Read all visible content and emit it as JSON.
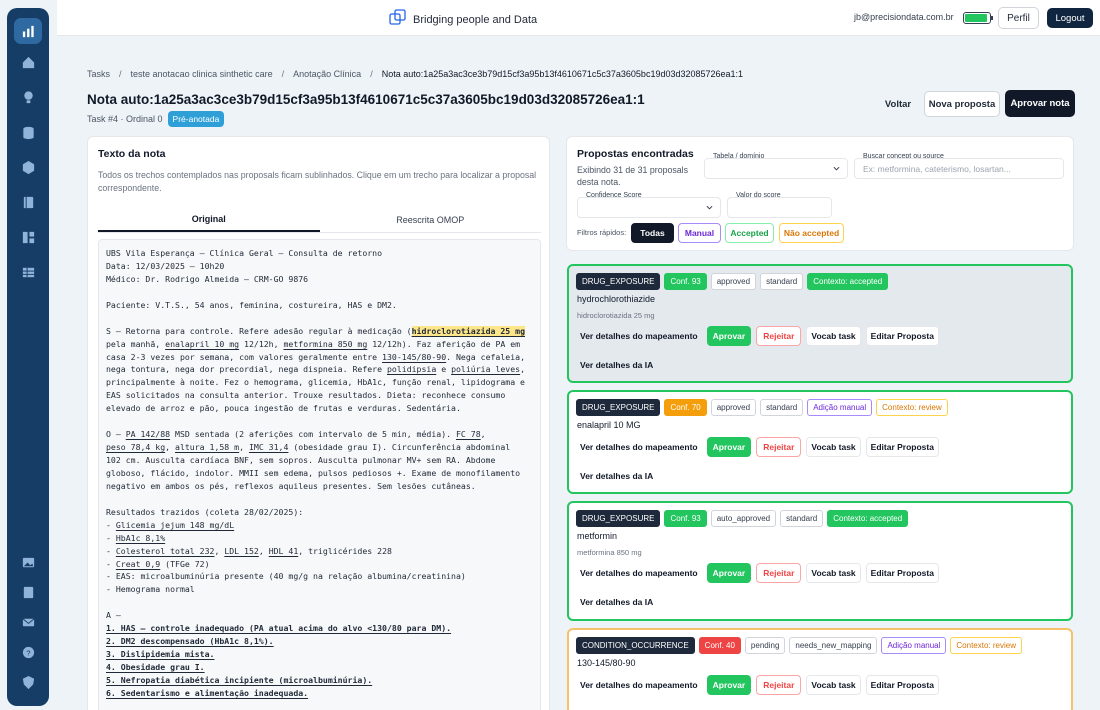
{
  "topbar": {
    "brand": "Bridging people and Data",
    "user_email": "jb@precisiondata.com.br",
    "battery_level": 0.9,
    "perfil_label": "Perfil",
    "logout_label": "Logout"
  },
  "breadcrumb": [
    "Tasks",
    "teste anotacao clinica sinthetic care",
    "Anotação Clínica",
    "Nota auto:1a25a3ac3ce3b79d15cf3a95b13f4610671c5c37a3605bc19d03d32085726ea1:1"
  ],
  "page": {
    "title": "Nota auto:1a25a3ac3ce3b79d15cf3a95b13f4610671c5c37a3605bc19d03d32085726ea1:1",
    "task_meta": "Task #4 · Ordinal 0",
    "status_badge": "Pré-anotada",
    "voltar_label": "Voltar",
    "nova_label": "Nova proposta",
    "aprovar_label": "Aprovar nota"
  },
  "note_panel": {
    "title": "Texto da nota",
    "description": "Todos os trechos contemplados nas proposals ficam sublinhados. Clique em um trecho para localizar a proposal correspondente.",
    "tabs": [
      "Original",
      "Reescrita OMOP"
    ],
    "lines": [
      [
        {
          "t": "UBS Vila Esperança — Clínica Geral — Consulta de retorno"
        }
      ],
      [
        {
          "t": "Data: 12/03/2025 — 10h20"
        }
      ],
      [
        {
          "t": "Médico: Dr. Rodrigo Almeida — CRM-GO 9876"
        }
      ],
      [
        {
          "t": ""
        }
      ],
      [
        {
          "t": "Paciente: V.T.S., 54 anos, feminina, costureira, HAS e DM2."
        }
      ],
      [
        {
          "t": ""
        }
      ],
      [
        {
          "t": "S — Retorna para controle. Refere adesão regular à medicação ("
        },
        {
          "t": "hidroclorotiazida 25 mg",
          "s": "strong"
        }
      ],
      [
        {
          "t": "pela manhã, "
        },
        {
          "t": "enalapril 10 mg",
          "s": "u"
        },
        {
          "t": " 12/12h, "
        },
        {
          "t": "metformina 850 mg",
          "s": "u"
        },
        {
          "t": " 12/12h). Faz aferição de PA em"
        }
      ],
      [
        {
          "t": "casa 2-3 vezes por semana, com valores geralmente entre "
        },
        {
          "t": "130-145/80-90",
          "s": "u"
        },
        {
          "t": ". Nega cefaleia,"
        }
      ],
      [
        {
          "t": "nega tontura, nega dor precordial, nega dispneia. Refere "
        },
        {
          "t": "polidipsia",
          "s": "u"
        },
        {
          "t": " e "
        },
        {
          "t": "poliúria leves",
          "s": "u"
        },
        {
          "t": ","
        }
      ],
      [
        {
          "t": "principalmente à noite. Fez o hemograma, glicemia, HbA1c, função renal, lipidograma e"
        }
      ],
      [
        {
          "t": "EAS solicitados na consulta anterior. Trouxe resultados. Dieta: reconhece consumo"
        }
      ],
      [
        {
          "t": "elevado de arroz e pão, pouca ingestão de frutas e verduras. Sedentária."
        }
      ],
      [
        {
          "t": ""
        }
      ],
      [
        {
          "t": "O — "
        },
        {
          "t": "PA 142/88",
          "s": "u"
        },
        {
          "t": " MSD sentada (2 aferições com intervalo de 5 min, média). "
        },
        {
          "t": "FC 78",
          "s": "u"
        },
        {
          "t": ","
        }
      ],
      [
        {
          "t": "peso 78,4 kg",
          "s": "u"
        },
        {
          "t": ", "
        },
        {
          "t": "altura 1,58 m",
          "s": "u"
        },
        {
          "t": ", "
        },
        {
          "t": "IMC 31,4",
          "s": "u"
        },
        {
          "t": " (obesidade grau I). Circunferência abdominal"
        }
      ],
      [
        {
          "t": "102 cm. Ausculta cardíaca BNF, sem sopros. Ausculta pulmonar MV+ sem RA. Abdome"
        }
      ],
      [
        {
          "t": "globoso, flácido, indolor. MMII sem edema, pulsos pediosos +. Exame de monofilamento"
        }
      ],
      [
        {
          "t": "negativo em ambos os pés, reflexos aquileus presentes. Sem lesões cutâneas."
        }
      ],
      [
        {
          "t": ""
        }
      ],
      [
        {
          "t": "Resultados trazidos (coleta 28/02/2025):"
        }
      ],
      [
        {
          "t": "- "
        },
        {
          "t": "Glicemia jejum 148 mg/dL",
          "s": "u"
        }
      ],
      [
        {
          "t": "- "
        },
        {
          "t": "HbA1c 8,1%",
          "s": "u"
        }
      ],
      [
        {
          "t": "- "
        },
        {
          "t": "Colesterol total 232",
          "s": "u"
        },
        {
          "t": ", "
        },
        {
          "t": "LDL 152",
          "s": "u"
        },
        {
          "t": ", "
        },
        {
          "t": "HDL 41",
          "s": "u"
        },
        {
          "t": ", triglicérides 228"
        }
      ],
      [
        {
          "t": "- "
        },
        {
          "t": "Creat 0,9",
          "s": "u"
        },
        {
          "t": " (TFGe 72)"
        }
      ],
      [
        {
          "t": "- EAS: microalbuminúria presente (40 mg/g na relação albumina/creatinina)"
        }
      ],
      [
        {
          "t": "- Hemograma normal"
        }
      ],
      [
        {
          "t": ""
        }
      ],
      [
        {
          "t": "A —"
        }
      ],
      [
        {
          "t": "1. HAS — controle inadequado (PA atual acima do alvo <130/80 para DM).",
          "s": "b"
        }
      ],
      [
        {
          "t": "2. DM2 descompensado (HbA1c 8,1%).",
          "s": "b"
        }
      ],
      [
        {
          "t": "3. Dislipidemia mista.",
          "s": "b"
        }
      ],
      [
        {
          "t": "4. Obesidade grau I.",
          "s": "b"
        }
      ],
      [
        {
          "t": "5. Nefropatia diabética incipiente (microalbuminúria).",
          "s": "b"
        }
      ],
      [
        {
          "t": "6. Sedentarismo e alimentação inadequada.",
          "s": "b"
        }
      ]
    ]
  },
  "proposals_panel": {
    "title": "Propostas encontradas",
    "count_text": "Exibindo 31 de 31 proposals desta nota.",
    "tabela_label": "Tabela / domínio",
    "tabela_value": "",
    "buscar_label": "Buscar concept ou source",
    "buscar_placeholder": "Ex: metformina, cateterismo, losartan...",
    "confidence_label": "Confidence Score",
    "valor_label": "Valor do score",
    "filters_label": "Filtros rápidos:",
    "filters": [
      "Todas",
      "Manual",
      "Accepted",
      "Não accepted"
    ]
  },
  "cards": [
    {
      "tags": [
        {
          "text": "DRUG_EXPOSURE",
          "kind": "dark"
        },
        {
          "text": "Conf. 93",
          "kind": "green"
        },
        {
          "text": "approved",
          "kind": "plain"
        },
        {
          "text": "standard",
          "kind": "plain"
        },
        {
          "text": "Contexto: accepted",
          "kind": "ctx-green"
        }
      ],
      "name": "hydrochlorothiazide",
      "source": "hidroclorotiazida 25 mg",
      "actions": {
        "details": "Ver detalhes do mapeamento",
        "approve": "Aprovar",
        "reject": "Rejeitar",
        "vocab": "Vocab task",
        "edit": "Editar Proposta"
      },
      "ia": "Ver detalhes da IA"
    },
    {
      "tags": [
        {
          "text": "DRUG_EXPOSURE",
          "kind": "dark"
        },
        {
          "text": "Conf. 70",
          "kind": "orange"
        },
        {
          "text": "approved",
          "kind": "plain"
        },
        {
          "text": "standard",
          "kind": "plain"
        },
        {
          "text": "Adição manual",
          "kind": "purple"
        },
        {
          "text": "Contexto: review",
          "kind": "ctx-review"
        }
      ],
      "name": "enalapril 10 MG",
      "source": "",
      "actions": {
        "details": "Ver detalhes do mapeamento",
        "approve": "Aprovar",
        "reject": "Rejeitar",
        "vocab": "Vocab task",
        "edit": "Editar Proposta"
      },
      "ia": "Ver detalhes da IA"
    },
    {
      "tags": [
        {
          "text": "DRUG_EXPOSURE",
          "kind": "dark"
        },
        {
          "text": "Conf. 93",
          "kind": "green"
        },
        {
          "text": "auto_approved",
          "kind": "plain"
        },
        {
          "text": "standard",
          "kind": "plain"
        },
        {
          "text": "Contexto: accepted",
          "kind": "ctx-green"
        }
      ],
      "name": "metformin",
      "source": "metformina 850 mg",
      "actions": {
        "details": "Ver detalhes do mapeamento",
        "approve": "Aprovar",
        "reject": "Rejeitar",
        "vocab": "Vocab task",
        "edit": "Editar Proposta"
      },
      "ia": "Ver detalhes da IA"
    },
    {
      "tags": [
        {
          "text": "CONDITION_OCCURRENCE",
          "kind": "dark"
        },
        {
          "text": "Conf. 40",
          "kind": "red"
        },
        {
          "text": "pending",
          "kind": "plain"
        },
        {
          "text": "needs_new_mapping",
          "kind": "plain"
        },
        {
          "text": "Adição manual",
          "kind": "purple"
        },
        {
          "text": "Contexto: review",
          "kind": "ctx-review"
        }
      ],
      "name": "130-145/80-90",
      "source": "",
      "actions": {
        "details": "Ver detalhes do mapeamento",
        "approve": "Aprovar",
        "reject": "Rejeitar",
        "vocab": "Vocab task",
        "edit": "Editar Proposta"
      },
      "ia": ""
    }
  ],
  "colors": {
    "sidebar": "#163d66",
    "accent_green": "#22c55e",
    "accent_orange": "#f59e0b",
    "accent_red": "#ef4444",
    "badge_blue": "#2f9fd7",
    "dark": "#111827"
  },
  "sidebar_icons": [
    "chart-icon",
    "home-icon",
    "lightbulb-icon",
    "database-icon",
    "cube-icon",
    "book-icon",
    "dashboard-icon",
    "table-icon",
    "image-icon",
    "notebook-icon",
    "mail-icon",
    "help-icon",
    "shield-icon"
  ]
}
